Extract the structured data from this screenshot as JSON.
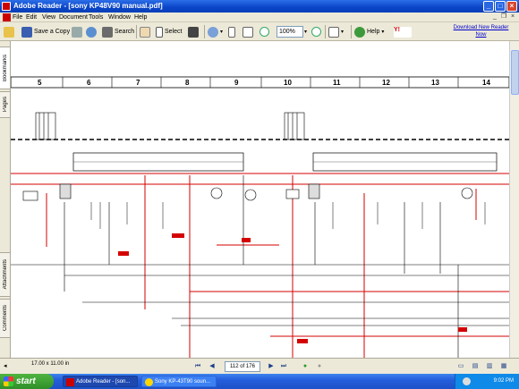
{
  "window": {
    "title": "Adobe Reader - [sony KP48V90 manual.pdf]"
  },
  "menu": [
    "File",
    "Edit",
    "View",
    "Document",
    "Tools",
    "Window",
    "Help"
  ],
  "toolbar": {
    "save_copy": "Save a Copy",
    "search": "Search",
    "select": "Select",
    "zoom": "100%",
    "help": "Help",
    "download_link": "Download New Reader Now"
  },
  "left_tabs": [
    "Bookmarks",
    "Pages",
    "Attachments",
    "Comments"
  ],
  "schematic": {
    "columns": [
      "5",
      "6",
      "7",
      "8",
      "9",
      "10",
      "11",
      "12",
      "13",
      "14"
    ]
  },
  "status": {
    "page_size": "17.00 x 11.00 in",
    "page_field": "112 of 176"
  },
  "taskbar": {
    "start": "start",
    "tasks": [
      "Adobe Reader - [son...",
      "Sony KP-43T90 soun..."
    ],
    "clock": "9:02 PM"
  },
  "colors": {
    "title_blue": "#0a45c8",
    "chrome": "#ece9d8",
    "schematic_red": "#d40000"
  }
}
